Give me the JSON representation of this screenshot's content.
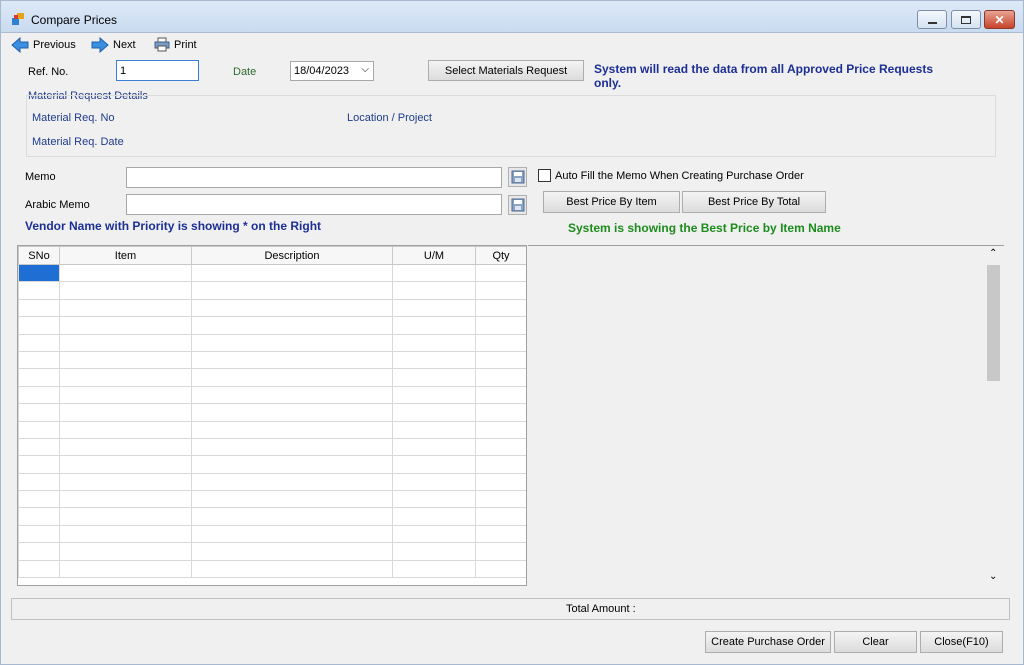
{
  "window": {
    "title": "Compare Prices"
  },
  "toolbar": {
    "previous": "Previous",
    "next": "Next",
    "print": "Print"
  },
  "header": {
    "ref_label": "Ref. No.",
    "ref_value": "1",
    "date_label": "Date",
    "date_value": "18/04/2023",
    "select_button": "Select Materials Request",
    "info_line1": "System will read the data from all Approved Price Requests",
    "info_line2": "only."
  },
  "details": {
    "group_title": "Material Request Details",
    "req_no_label": "Material Req. No",
    "location_label": "Location / Project",
    "req_date_label": "Material Req. Date"
  },
  "memo": {
    "memo_label": "Memo",
    "memo_value": "",
    "arabic_label": "Arabic Memo",
    "arabic_value": "",
    "autofill_label": "Auto Fill the Memo When Creating Purchase Order",
    "autofill_checked": false,
    "best_item_button": "Best Price By Item",
    "best_total_button": "Best Price By Total",
    "vendor_note": "Vendor Name with Priority is showing * on the Right",
    "system_note": "System is showing the Best Price by Item Name"
  },
  "grid": {
    "columns": [
      "SNo",
      "Item",
      "Description",
      "U/M",
      "Qty"
    ],
    "row_count": 18
  },
  "footer": {
    "total_label": "Total Amount :",
    "create_po_button": "Create Purchase Order",
    "clear_button": "Clear",
    "close_button": "Close(F10)"
  },
  "colors": {
    "info_blue": "#1c2f95",
    "info_green": "#1c8c1c",
    "selection": "#1e6ed4"
  }
}
